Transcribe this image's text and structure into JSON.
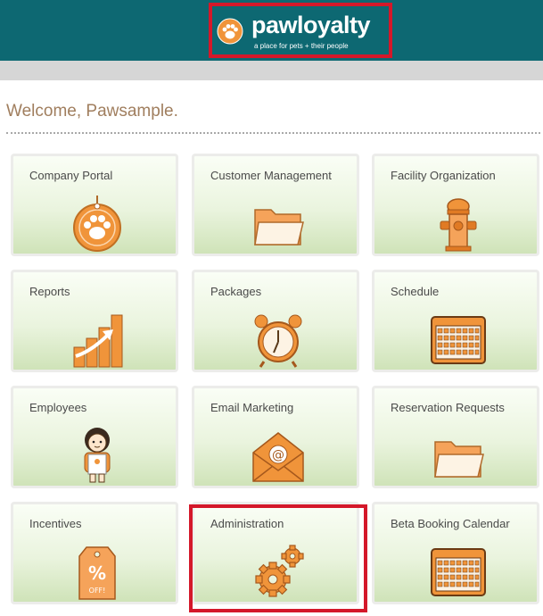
{
  "header": {
    "logo_text": "pawloyalty",
    "tagline": "a place for pets + their people",
    "background": "#0d6872",
    "highlight_color": "#d4182a"
  },
  "welcome": "Welcome, Pawsample.",
  "tiles": [
    {
      "label": "Company Portal",
      "icon": "paw-tag-icon"
    },
    {
      "label": "Customer Management",
      "icon": "folder-icon"
    },
    {
      "label": "Facility Organization",
      "icon": "fire-hydrant-icon"
    },
    {
      "label": "Reports",
      "icon": "bar-chart-icon"
    },
    {
      "label": "Packages",
      "icon": "alarm-clock-icon"
    },
    {
      "label": "Schedule",
      "icon": "calendar-icon"
    },
    {
      "label": "Employees",
      "icon": "employee-avatar-icon"
    },
    {
      "label": "Email Marketing",
      "icon": "email-envelope-icon"
    },
    {
      "label": "Reservation Requests",
      "icon": "folder-icon"
    },
    {
      "label": "Incentives",
      "icon": "discount-tag-icon"
    },
    {
      "label": "Administration",
      "icon": "gears-icon"
    },
    {
      "label": "Beta Booking Calendar",
      "icon": "calendar-icon"
    }
  ],
  "incentive_tag_text": "OFF!",
  "accent": "#f0943a"
}
